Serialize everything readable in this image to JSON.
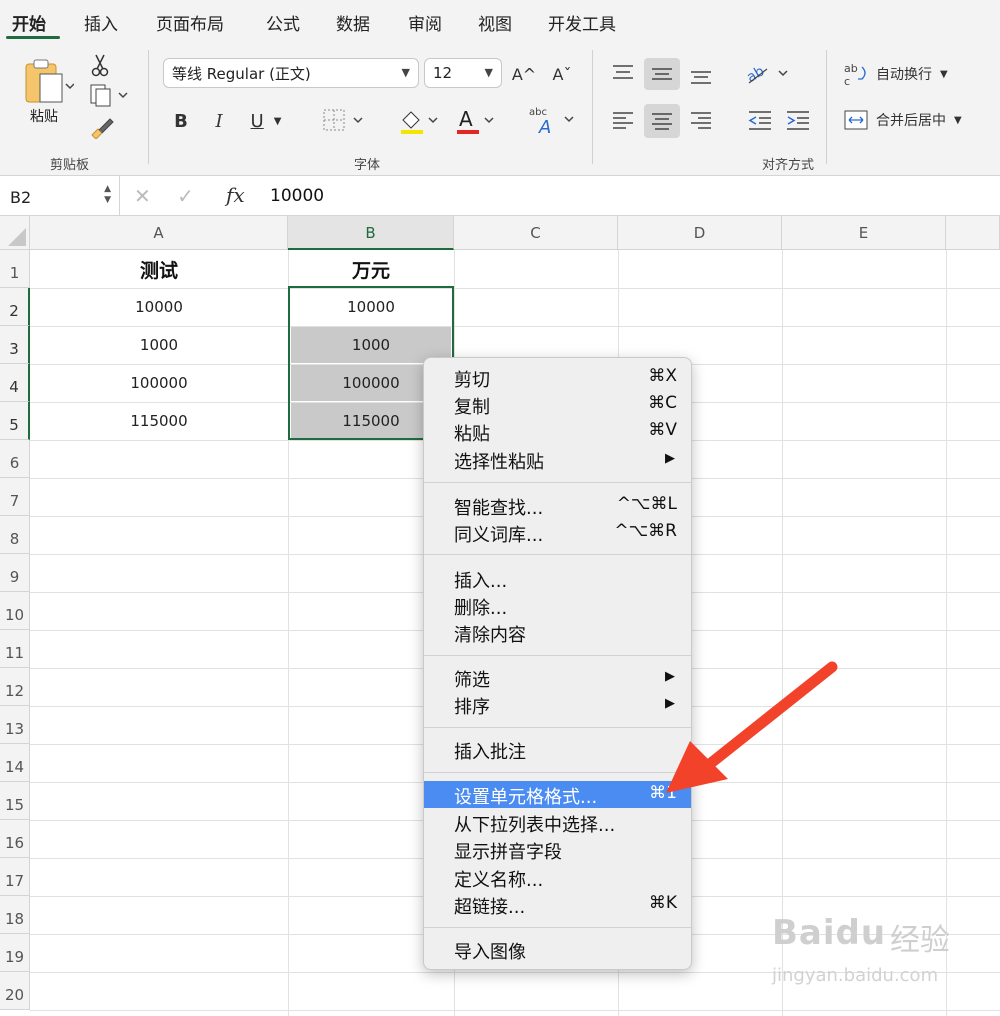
{
  "ribbon": {
    "tabs": [
      "开始",
      "插入",
      "页面布局",
      "公式",
      "数据",
      "审阅",
      "视图",
      "开发工具"
    ],
    "clipboard": {
      "paste_label": "粘贴",
      "group_label": "剪贴板"
    },
    "font": {
      "name": "等线 Regular (正文)",
      "size": "12",
      "group_label": "字体",
      "bold": "B",
      "italic": "I",
      "underline": "U",
      "grow": "A^",
      "shrink": "Aˇ",
      "color_accent": "#e52424",
      "highlight_accent": "#f2e600"
    },
    "alignment": {
      "wrap_label": "自动换行",
      "merge_label": "合并后居中",
      "group_label": "对齐方式"
    }
  },
  "formula_bar": {
    "name_box": "B2",
    "fx": "fx",
    "value": "10000"
  },
  "sheet": {
    "columns": [
      "A",
      "B",
      "C",
      "D",
      "E"
    ],
    "rows": [
      "1",
      "2",
      "3",
      "4",
      "5",
      "6",
      "7",
      "8",
      "9",
      "10",
      "11",
      "12",
      "13",
      "14",
      "15",
      "16",
      "17",
      "18",
      "19",
      "20"
    ],
    "cells": {
      "A1": "测试",
      "B1": "万元",
      "A2": "10000",
      "B2": "10000",
      "A3": "1000",
      "B3": "1000",
      "A4": "100000",
      "B4": "100000",
      "A5": "115000",
      "B5": "115000"
    },
    "accent": "#1f6b3f"
  },
  "context_menu": {
    "items": [
      {
        "label": "剪切",
        "shortcut": "⌘X"
      },
      {
        "label": "复制",
        "shortcut": "⌘C"
      },
      {
        "label": "粘贴",
        "shortcut": "⌘V"
      },
      {
        "label": "选择性粘贴",
        "submenu": "▶"
      },
      {
        "label": "智能查找...",
        "shortcut": "^⌥⌘L"
      },
      {
        "label": "同义词库...",
        "shortcut": "^⌥⌘R"
      },
      {
        "label": "插入..."
      },
      {
        "label": "删除..."
      },
      {
        "label": "清除内容"
      },
      {
        "label": "筛选",
        "submenu": "▶"
      },
      {
        "label": "排序",
        "submenu": "▶"
      },
      {
        "label": "插入批注"
      },
      {
        "label": "设置单元格格式...",
        "shortcut": "⌘1",
        "highlighted": true
      },
      {
        "label": "从下拉列表中选择..."
      },
      {
        "label": "显示拼音字段"
      },
      {
        "label": "定义名称..."
      },
      {
        "label": "超链接...",
        "shortcut": "⌘K"
      },
      {
        "label": "导入图像"
      }
    ],
    "highlight_color": "#4a8cf2"
  },
  "watermark": {
    "brand": "Baidu",
    "brand_cn": "经验",
    "url": "jingyan.baidu.com"
  }
}
